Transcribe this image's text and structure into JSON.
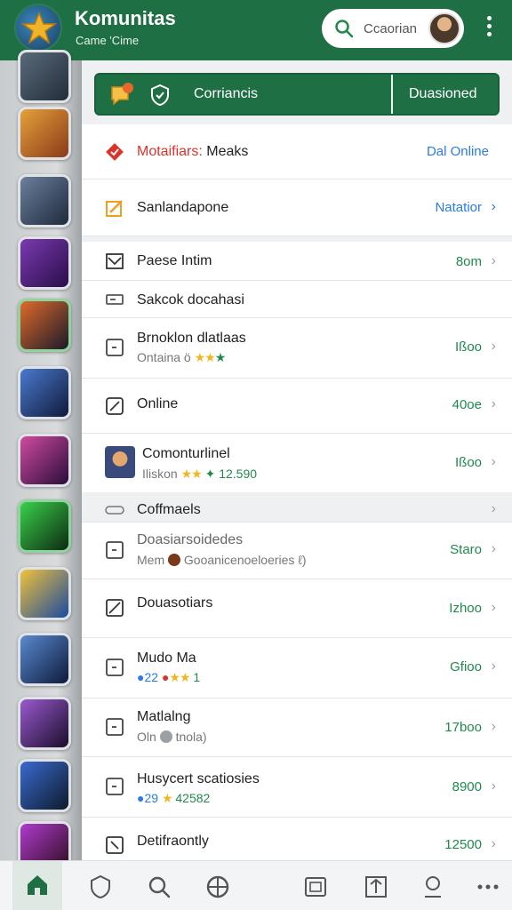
{
  "header": {
    "title": "Komunitas",
    "subtitle": "Came 'Cime",
    "search_text": "Ccaorian"
  },
  "top_bar": {
    "left_label": "Corriancis",
    "right_label": "Duasioned"
  },
  "rows": {
    "notif": {
      "title_red": "Motaifiars:",
      "title_rest": " Meaks",
      "value": "Dal Online"
    },
    "sort": {
      "title": "Sanlandapone",
      "value": "Natatior"
    },
    "passe": {
      "title": "Paese Intim",
      "value": "8om"
    },
    "sakcok": {
      "title": "Sakcok docahasi"
    },
    "brnoklon": {
      "title": "Brnoklon dlatlaas",
      "sub": "Ontaina ö",
      "value": "Ißoo"
    },
    "online": {
      "title": "Online",
      "value": "40oe"
    },
    "comonturline": {
      "title": "Comonturlinel",
      "sub_a": "Iliskon",
      "sub_b": "12.590",
      "value": "Ißoo"
    },
    "coffmaels": {
      "title": "Coffmaels"
    },
    "doasiar": {
      "title": "Doasiarsoidedes",
      "sub": "Mem",
      "sub_b": "Gooanicenoeloeries ℓ)",
      "value": "Staro"
    },
    "douasotlars": {
      "title": "Douasotiars",
      "value": "Izhoo"
    },
    "mudo": {
      "title": "Mudo Ma",
      "sub": "22",
      "sub_b": "1",
      "value": "Gfioo"
    },
    "matlalng": {
      "title": "Matlalng",
      "sub": "Oln",
      "sub_b": "tnola)",
      "value": "17boo"
    },
    "husycert": {
      "title": "Husycert scatiosies",
      "sub": "29",
      "sub_b": "42582",
      "value": "8900"
    },
    "detifraontly": {
      "title": "Detifraontly",
      "value": "12500"
    }
  },
  "colors": {
    "brand_green": "#1f6f45",
    "value_green": "#1f8a4c",
    "link_blue": "#2a7be4",
    "alert_red": "#d9342b",
    "star_yellow": "#f2b620"
  },
  "icons": [
    "app-logo-star-icon",
    "search-icon",
    "avatar",
    "kebab-menu-icon",
    "chat-icon",
    "shield-check-icon",
    "home-icon",
    "shield-icon",
    "search-nav-icon",
    "globe-icon",
    "gallery-icon",
    "upload-icon",
    "profile-icon",
    "more-icon"
  ]
}
